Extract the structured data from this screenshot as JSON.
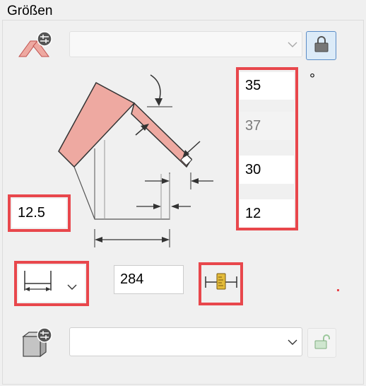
{
  "group": {
    "title": "Größen"
  },
  "profile_combo": {
    "value": ""
  },
  "angles": {
    "top": "35",
    "second": "37",
    "third": "30",
    "bottom": "12",
    "unit": "°"
  },
  "left_value": "12.5",
  "length": {
    "value": "284"
  },
  "material_combo": {
    "value": ""
  },
  "icons": {
    "profile": "roof-profile-settings-icon",
    "lock": "lock-icon",
    "unlock": "unlock-icon",
    "length_type": "length-type-icon",
    "measure": "measure-ruler-icon",
    "material": "material-settings-icon"
  },
  "colors": {
    "highlight": "#e8474c",
    "roof_fill": "#eea9a1",
    "lock_button": "#dcebf8"
  }
}
